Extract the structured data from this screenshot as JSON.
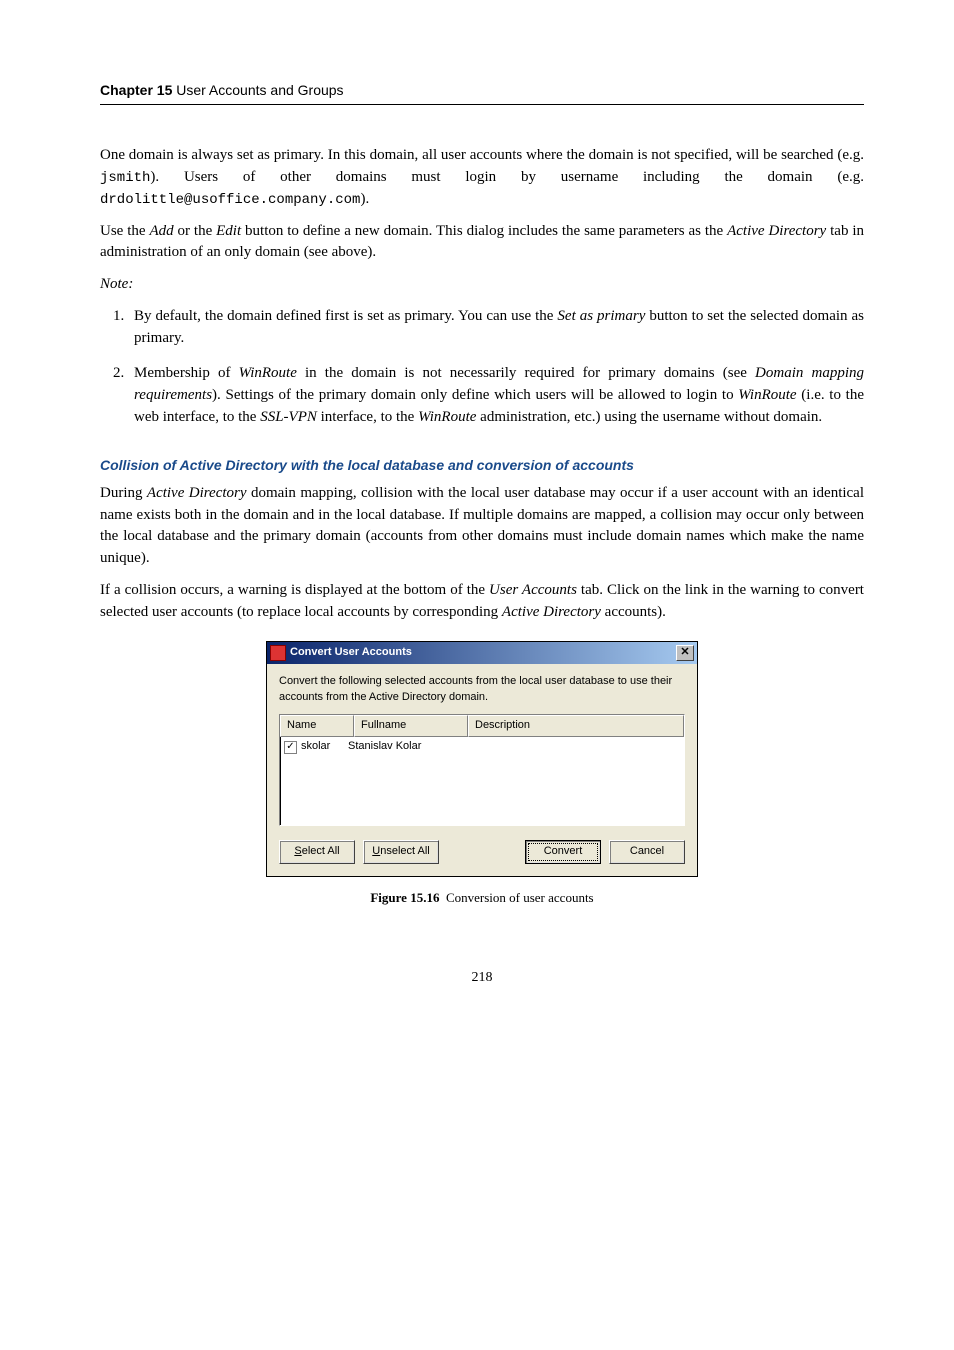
{
  "chapter": {
    "label": "Chapter 15",
    "title": "User Accounts and Groups"
  },
  "p1a": "One domain is always set as primary. In this domain, all user accounts where the domain is not specified, will be searched (e.g. ",
  "p1_code1": "jsmith",
  "p1b": "). Users of other domains must login by username including the domain (e.g. ",
  "p1_code2": "drdolittle@usoffice.company.com",
  "p1c": ").",
  "p2a": "Use the ",
  "p2_it1": "Add",
  "p2b": " or the ",
  "p2_it2": "Edit",
  "p2c": " button to define a new domain. This dialog includes the same parameters as the ",
  "p2_it3": "Active Directory",
  "p2d": " tab in administration of an only domain (see above).",
  "note_label": "Note:",
  "li1a": "By default, the domain defined first is set as primary. You can use the ",
  "li1_it": "Set as primary",
  "li1b": " button to set the selected domain as primary.",
  "li2a": "Membership of ",
  "li2_it1": "WinRoute",
  "li2b": " in the domain is not necessarily required for primary domains (see ",
  "li2_it2": "Domain mapping requirements",
  "li2c": "). Settings of the primary domain only define which users will be allowed to login to ",
  "li2_it3": "WinRoute",
  "li2d": " (i.e. to the web interface, to the ",
  "li2_it4": "SSL-VPN",
  "li2e": " interface, to the ",
  "li2_it5": "WinRoute",
  "li2f": " administration, etc.) using the username without domain.",
  "section_title": "Collision of Active Directory with the local database and conversion of accounts",
  "p3a": "During ",
  "p3_it1": "Active Directory",
  "p3b": " domain mapping, collision with the local user database may occur if a user account with an identical name exists both in the domain and in the local database. If multiple domains are mapped, a collision may occur only between the local database and the primary domain (accounts from other domains must include domain names which make the name unique).",
  "p4a": "If a collision occurs, a warning is displayed at the bottom of the ",
  "p4_it1": "User Accounts",
  "p4b": " tab. Click on the link in the warning to convert selected user accounts (to replace local accounts by corresponding ",
  "p4_it2": "Active Directory",
  "p4c": " accounts).",
  "dialog": {
    "title": "Convert User Accounts",
    "msg": "Convert the following selected accounts from the local user database to use their accounts from the Active Directory domain.",
    "cols": {
      "name": "Name",
      "fullname": "Fullname",
      "description": "Description"
    },
    "rows": [
      {
        "checked": "✓",
        "name": "skolar",
        "fullname": "Stanislav Kolar",
        "description": ""
      }
    ],
    "buttons": {
      "select_all": "Select All",
      "unselect_all": "Unselect All",
      "convert": "Convert",
      "cancel": "Cancel"
    }
  },
  "figure": {
    "label": "Figure 15.16",
    "caption": "Conversion of user accounts"
  },
  "page_number": "218"
}
